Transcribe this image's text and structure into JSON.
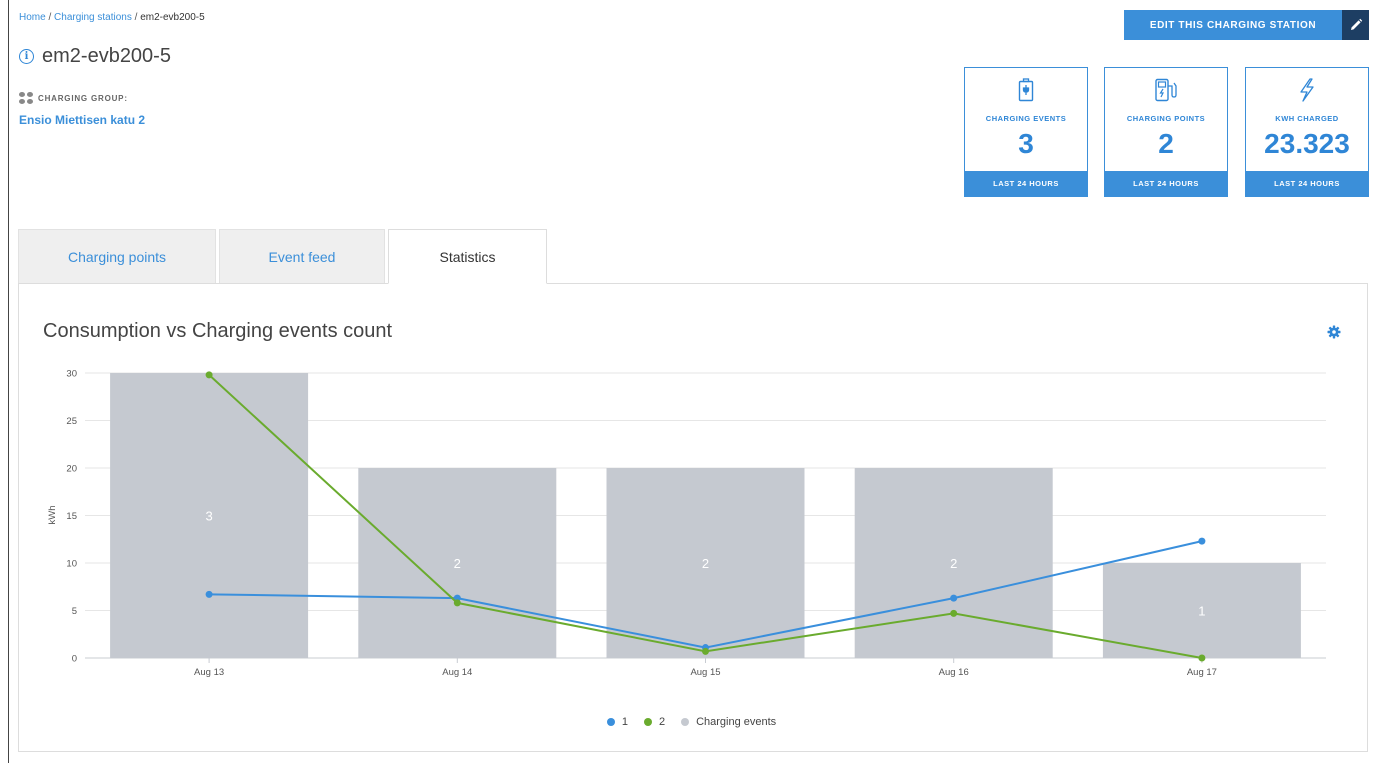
{
  "breadcrumb": {
    "home": "Home",
    "stations": "Charging stations",
    "current": "em2-evb200-5",
    "sep": " / "
  },
  "page": {
    "title": "em2-evb200-5"
  },
  "group": {
    "label": "CHARGING GROUP:",
    "name": "Ensio Miettisen katu 2"
  },
  "actions": {
    "edit_label": "EDIT THIS CHARGING STATION"
  },
  "stats": [
    {
      "label": "CHARGING EVENTS",
      "value": "3",
      "footer": "LAST 24 HOURS",
      "icon": "battery-icon"
    },
    {
      "label": "CHARGING POINTS",
      "value": "2",
      "footer": "LAST 24 HOURS",
      "icon": "charger-icon"
    },
    {
      "label": "KWH CHARGED",
      "value": "23.323",
      "footer": "LAST 24 HOURS",
      "icon": "lightning-icon"
    }
  ],
  "tabs": [
    {
      "label": "Charging points",
      "active": false
    },
    {
      "label": "Event feed",
      "active": false
    },
    {
      "label": "Statistics",
      "active": true
    }
  ],
  "colors": {
    "accent": "#3b8fd9",
    "dark": "#1d3e63",
    "series1": "#3a8fdc",
    "series2": "#6aab2e",
    "bars": "#c5c9d0"
  },
  "chart_data": {
    "type": "bar",
    "title": "Consumption vs Charging events count",
    "ylabel": "kWh",
    "ylim": [
      0,
      30
    ],
    "yticks": [
      0,
      5,
      10,
      15,
      20,
      25,
      30
    ],
    "categories": [
      "Aug 13",
      "Aug 14",
      "Aug 15",
      "Aug 16",
      "Aug 17"
    ],
    "bars": {
      "name": "Charging events",
      "values": [
        3,
        2,
        2,
        2,
        1
      ],
      "scaled_to_axis": [
        30,
        20,
        20,
        20,
        10
      ]
    },
    "series": [
      {
        "name": "1",
        "type": "line",
        "values": [
          6.7,
          6.3,
          1.1,
          6.3,
          12.3
        ]
      },
      {
        "name": "2",
        "type": "line",
        "values": [
          29.8,
          5.8,
          0.7,
          4.7,
          0
        ]
      }
    ],
    "grid": true,
    "legend_position": "bottom-center"
  }
}
